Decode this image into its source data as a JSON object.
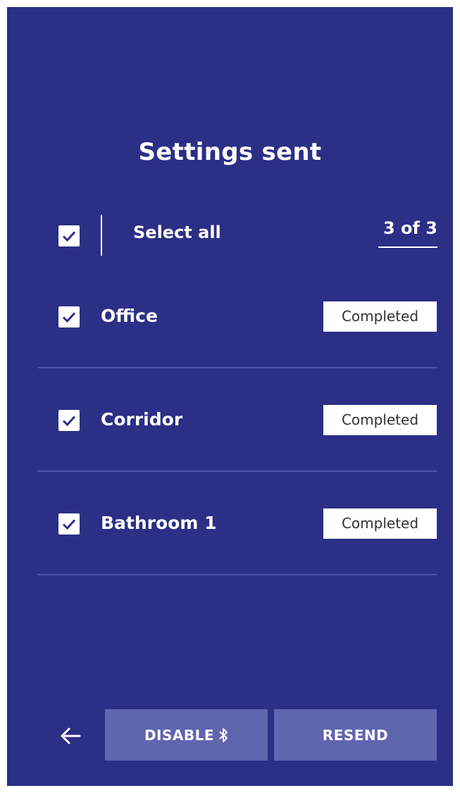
{
  "header": {
    "title": "Settings sent"
  },
  "select_all": {
    "label": "Select all",
    "checked": true,
    "count": "3 of 3"
  },
  "rooms": [
    {
      "label": "Office",
      "checked": true,
      "status": "Completed"
    },
    {
      "label": "Corridor",
      "checked": true,
      "status": "Completed"
    },
    {
      "label": "Bathroom 1",
      "checked": true,
      "status": "Completed"
    }
  ],
  "footer": {
    "back_icon": "arrow-left-icon",
    "disable_label": "DISABLE",
    "disable_icon": "bluetooth-icon",
    "resend_label": "RESEND"
  },
  "colors": {
    "background": "#2b2f86",
    "button": "#6065b0",
    "divider": "#4e54a6"
  }
}
